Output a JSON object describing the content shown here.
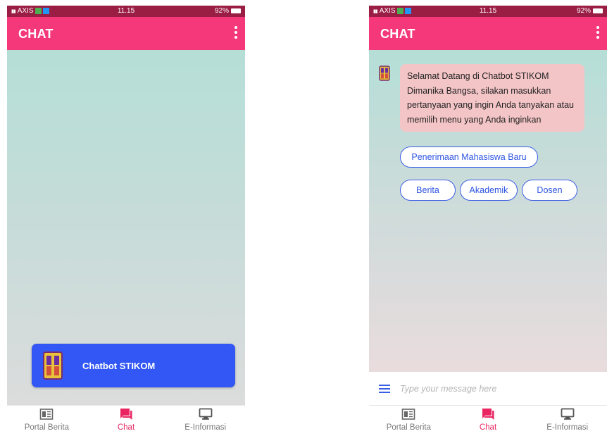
{
  "colors": {
    "status_bar": "#9a1d43",
    "app_bar": "#f4387a",
    "accent_pink": "#e92662",
    "chip_blue": "#3a5ee6",
    "card_blue": "#3357f5",
    "bubble_pink": "#f4c5c7"
  },
  "status_bar": {
    "carrier": "AXIS",
    "time": "11.15",
    "battery": "92%"
  },
  "app_bar": {
    "title": "CHAT",
    "menu_icon": "more-vertical-icon"
  },
  "left_screen": {
    "bot_card": {
      "title": "Chatbot STIKOM",
      "icon": "stikom-logo-icon"
    }
  },
  "right_screen": {
    "bot_message": "Selamat Datang di Chatbot STIKOM Dimanika Bangsa, silakan masukkan pertanyaan yang ingin Anda tanyakan atau memilih menu yang Anda inginkan",
    "quick_replies": [
      "Penerimaan Mahasiswa Baru",
      "Berita",
      "Akademik",
      "Dosen"
    ],
    "input_placeholder": "Type your message here",
    "input_icon": "hamburger-menu-icon"
  },
  "bottom_nav": {
    "items": [
      {
        "label": "Portal Berita",
        "icon": "newspaper-icon",
        "active": false
      },
      {
        "label": "Chat",
        "icon": "chat-icon",
        "active": true
      },
      {
        "label": "E-Informasi",
        "icon": "monitor-icon",
        "active": false
      }
    ]
  }
}
